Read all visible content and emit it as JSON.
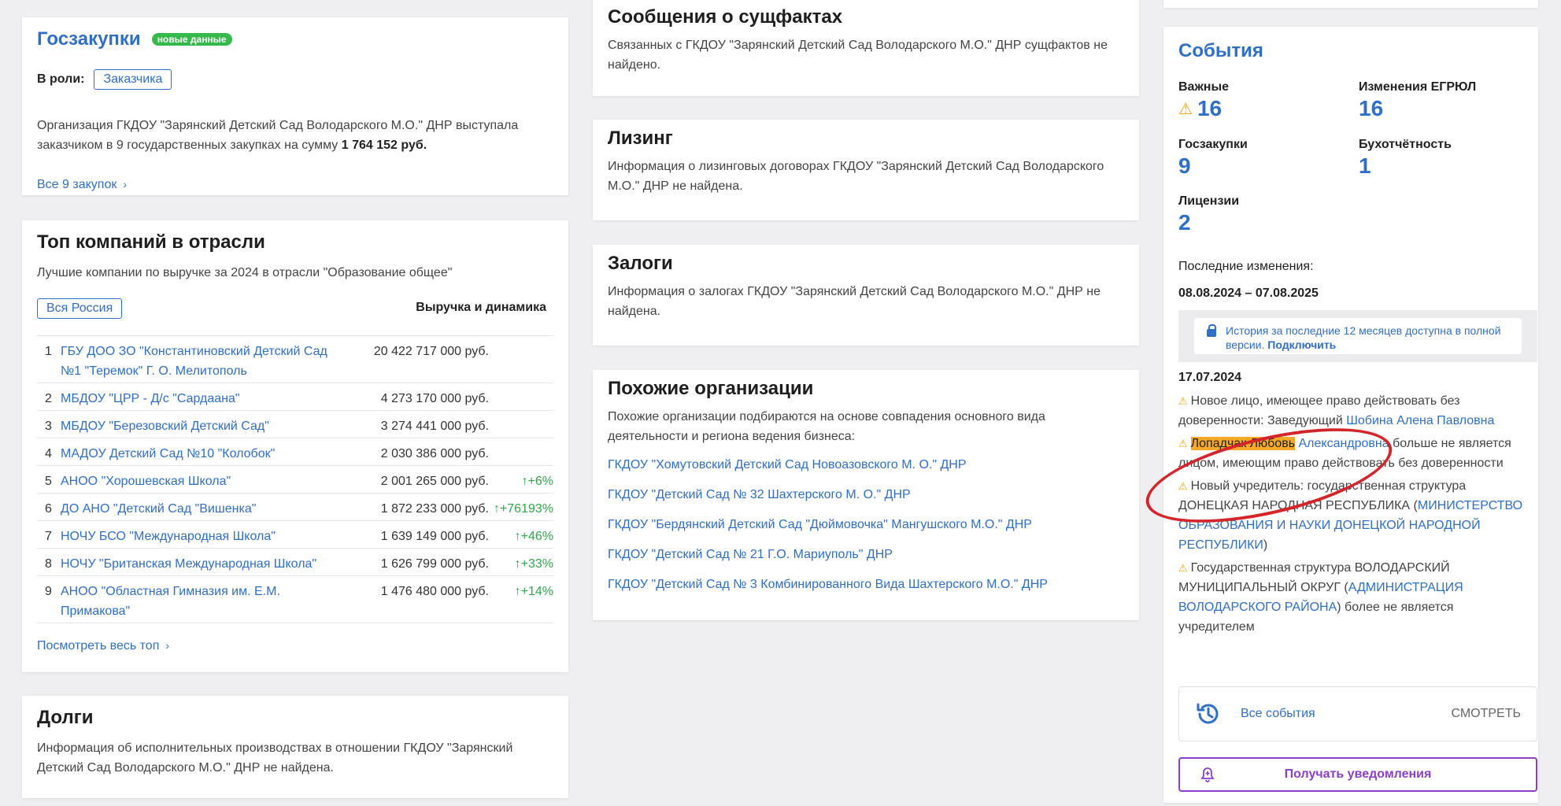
{
  "goszakupki": {
    "title": "Госзакупки",
    "badge": "новые данные",
    "role_label": "В роли:",
    "role_tag": "Заказчика",
    "desc_text": "Организация ГКДОУ \"Зарянский Детский Сад Володарского М.О.\" ДНР выступала заказчиком в 9 государственных закупках на сумму ",
    "desc_amount": "1 764 152 руб.",
    "all_link": "Все 9 закупок"
  },
  "top": {
    "title": "Топ компаний в отрасли",
    "subtitle": "Лучшие компании по выручке за 2024 в отрасли \"Образование общее\"",
    "region": "Вся Россия",
    "rev_header": "Выручка и динамика",
    "rows": [
      {
        "n": "1",
        "name": "ГБУ ДОО ЗО \"Константиновский Детский Сад №1 \"Теремок\" Г. О. Мелитополь",
        "rev": "20 422 717 000 руб.",
        "dyn": ""
      },
      {
        "n": "2",
        "name": "МБДОУ \"ЦРР - Д/с \"Сардаана\"",
        "rev": "4 273 170 000 руб.",
        "dyn": ""
      },
      {
        "n": "3",
        "name": "МБДОУ \"Березовский Детский Сад\"",
        "rev": "3 274 441 000 руб.",
        "dyn": ""
      },
      {
        "n": "4",
        "name": "МАДОУ Детский Сад №10 \"Колобок\"",
        "rev": "2 030 386 000 руб.",
        "dyn": ""
      },
      {
        "n": "5",
        "name": "АНОО \"Хорошевская Школа\"",
        "rev": "2 001 265 000 руб.",
        "dyn": "↑+6%"
      },
      {
        "n": "6",
        "name": "ДО АНО \"Детский Сад \"Вишенка\"",
        "rev": "1 872 233 000 руб.",
        "dyn": "↑+76193%"
      },
      {
        "n": "7",
        "name": "НОЧУ БСО \"Международная Школа\"",
        "rev": "1 639 149 000 руб.",
        "dyn": "↑+46%"
      },
      {
        "n": "8",
        "name": "НОЧУ \"Британская Международная Школа\"",
        "rev": "1 626 799 000 руб.",
        "dyn": "↑+33%"
      },
      {
        "n": "9",
        "name": "АНОО \"Областная Гимназия им. Е.М. Примакова\"",
        "rev": "1 476 480 000 руб.",
        "dyn": "↑+14%"
      }
    ],
    "see_all": "Посмотреть весь топ"
  },
  "dolgi": {
    "title": "Долги",
    "desc": "Информация об исполнительных производствах в отношении ГКДОУ \"Зарянский Детский Сад Володарского М.О.\" ДНР не найдена."
  },
  "sf": {
    "title": "Сообщения о сущфактах",
    "desc": "Связанных с ГКДОУ \"Зарянский Детский Сад Володарского М.О.\" ДНР сущфактов не найдено."
  },
  "lz": {
    "title": "Лизинг",
    "desc": "Информация о лизинговых договорах ГКДОУ \"Зарянский Детский Сад Володарского М.О.\" ДНР не найдена."
  },
  "zl": {
    "title": "Залоги",
    "desc": "Информация о залогах ГКДОУ \"Зарянский Детский Сад Володарского М.О.\" ДНР не найдена."
  },
  "po": {
    "title": "Похожие организации",
    "desc": "Похожие организации подбираются на основе совпадения основного вида деятельности и региона ведения бизнеса:",
    "links": [
      "ГКДОУ \"Хомутовский Детский Сад Новоазовского М. О.\" ДНР",
      "ГКДОУ \"Детский Сад № 32 Шахтерского М. О.\" ДНР",
      "ГКДОУ \"Бердянский Детский Сад \"Дюймовочка\" Мангушского М.О.\" ДНР",
      "ГКДОУ \"Детский Сад № 21 Г.О. Мариуполь\" ДНР",
      "ГКДОУ \"Детский Сад № 3 Комбинированного Вида Шахтерского М.О.\" ДНР"
    ]
  },
  "events": {
    "title": "События",
    "stats": {
      "important_label": "Важные",
      "important_val": "16",
      "egrul_label": "Изменения ЕГРЮЛ",
      "egrul_val": "16",
      "gz_label": "Госзакупки",
      "gz_val": "9",
      "buh_label": "Бухотчётность",
      "buh_val": "1",
      "lic_label": "Лицензии",
      "lic_val": "2"
    },
    "last_changes": "Последние изменения:",
    "range": "08.08.2024 – 07.08.2025",
    "lock_text": "История за последние 12 месяцев доступна в полной версии. ",
    "lock_link": "Подключить",
    "date": "17.07.2024",
    "ev1_text": "Новое лицо, имеющее право действовать без доверенности: Заведующий ",
    "ev1_link": "Шобина Алена Павловна",
    "ev2_hl": "Лопадчак Любовь",
    "ev2_link": " Александровна",
    "ev2_text": " больше не является лицом, имеющим право действовать без доверенности",
    "ev3_text": "Новый учредитель: государственная структура ДОНЕЦКАЯ НАРОДНАЯ РЕСПУБЛИКА (",
    "ev3_link": "МИНИСТЕРСТВО ОБРАЗОВАНИЯ И НАУКИ ДОНЕЦКОЙ НАРОДНОЙ РЕСПУБЛИКИ",
    "ev3_end": ")",
    "ev4_text": "Государственная структура ВОЛОДАРСКИЙ МУНИЦИПАЛЬНЫЙ ОКРУГ (",
    "ev4_link": "АДМИНИСТРАЦИЯ ВОЛОДАРСКОГО РАЙОНА",
    "ev4_end": ") более не является учредителем",
    "all_events": "Все события",
    "see": "СМОТРЕТЬ",
    "notify": "Получать уведомления"
  }
}
